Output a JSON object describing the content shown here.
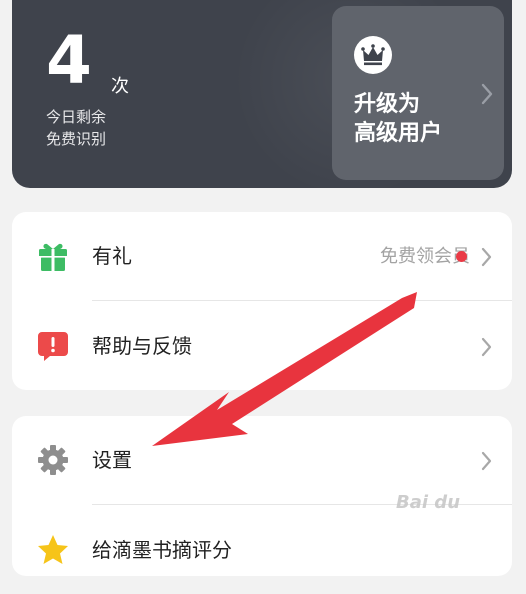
{
  "quota": {
    "count": "4",
    "unit": "次",
    "label_line1": "今日剩余",
    "label_line2": "免费识别"
  },
  "upgrade": {
    "title_line1": "升级为",
    "title_line2": "高级用户",
    "icon": "crown-icon"
  },
  "menu": {
    "gift": {
      "label": "有礼",
      "promo": "免费领会员",
      "icon": "gift-icon"
    },
    "help": {
      "label": "帮助与反馈",
      "icon": "feedback-icon"
    },
    "settings": {
      "label": "设置",
      "icon": "gear-icon"
    },
    "rate": {
      "label": "给滴墨书摘评分",
      "icon": "star-icon"
    }
  },
  "watermark": "Bai du",
  "colors": {
    "card_dark": "#3f434c",
    "upgrade_panel": "#60646c",
    "gift_green": "#3dbc64",
    "help_red": "#ec4a4a",
    "star_yellow": "#f6c419",
    "dot_red": "#ea3a46",
    "arrow_red": "#e8343e"
  }
}
